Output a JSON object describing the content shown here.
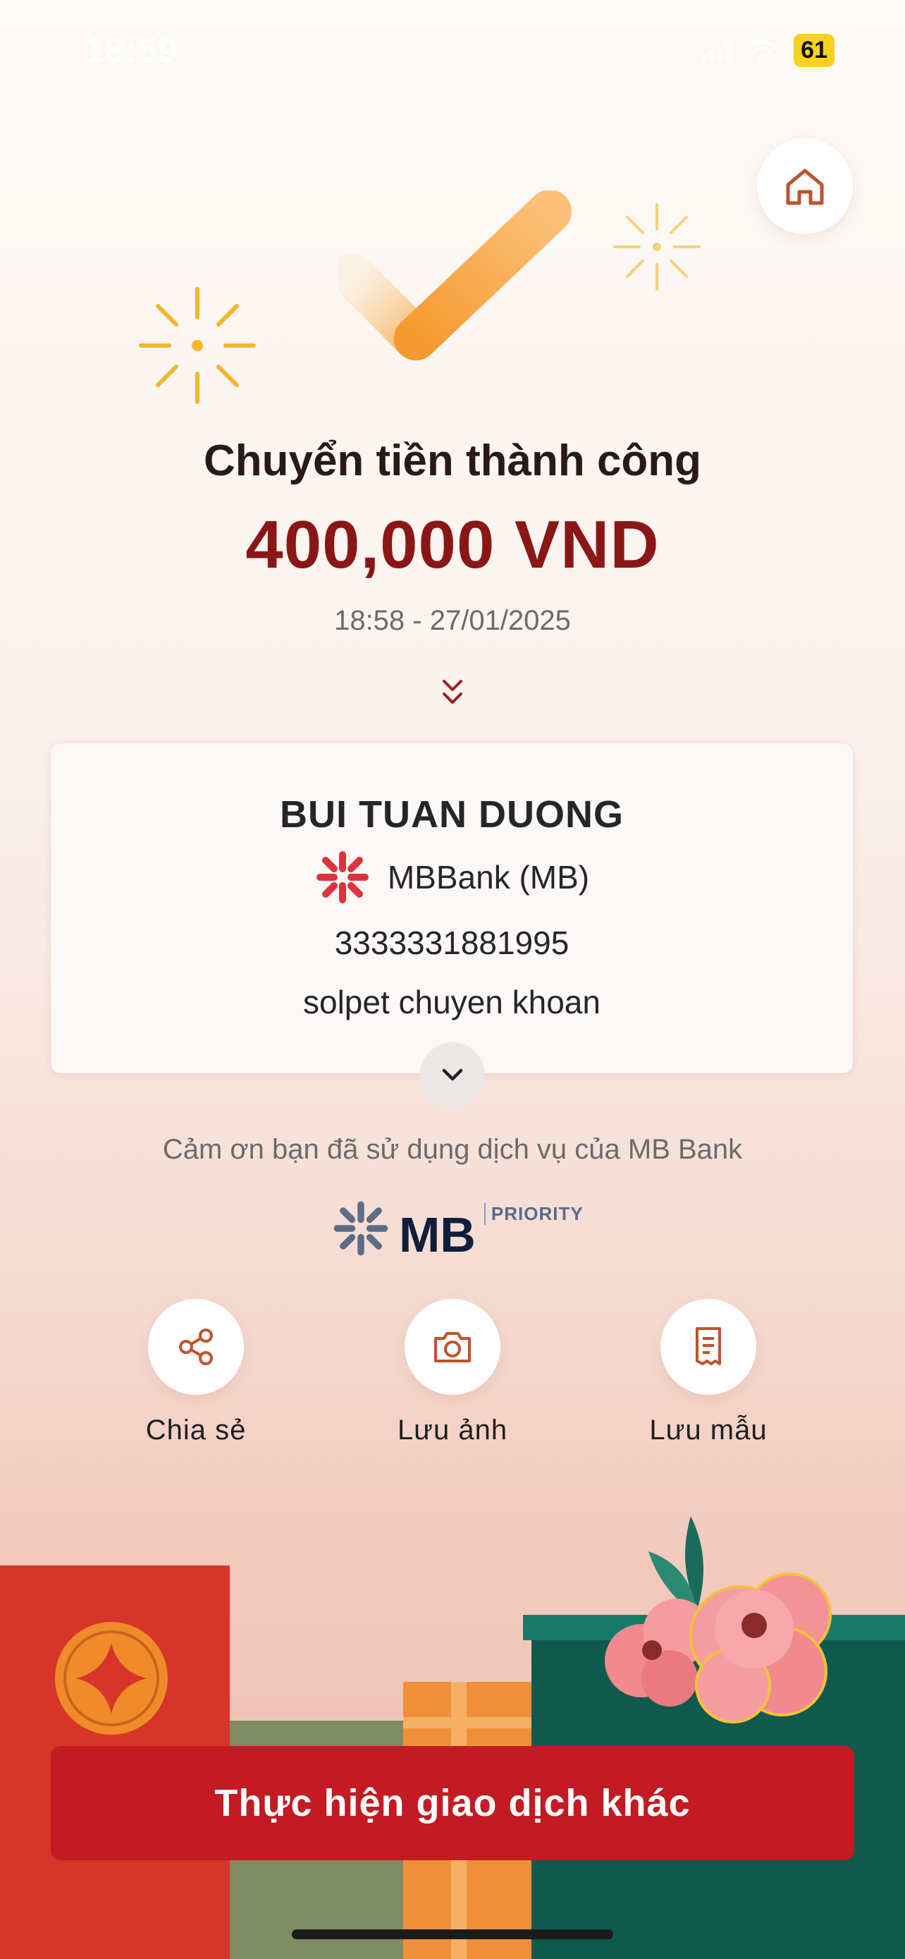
{
  "status_bar": {
    "time": "18:59",
    "battery": "61"
  },
  "header": {
    "home_icon": "home-icon"
  },
  "result": {
    "title": "Chuyển tiền thành công",
    "amount": "400,000 VND",
    "datetime": "18:58 - 27/01/2025"
  },
  "recipient": {
    "name": "BUI TUAN DUONG",
    "bank": "MBBank (MB)",
    "account": "3333331881995",
    "memo": "solpet chuyen khoan"
  },
  "footer": {
    "thanks": "Cảm ơn bạn đã sử dụng dịch vụ của MB Bank",
    "logo_text": "MB",
    "logo_sub": "PRIORITY"
  },
  "actions": [
    {
      "label": "Chia sẻ",
      "icon": "share-icon"
    },
    {
      "label": "Lưu ảnh",
      "icon": "camera-icon"
    },
    {
      "label": "Lưu mẫu",
      "icon": "receipt-icon"
    }
  ],
  "cta": {
    "label": "Thực hiện giao dịch khác"
  },
  "colors": {
    "accent": "#c21b23",
    "amount": "#8b1616",
    "check": "#f5a03c"
  }
}
